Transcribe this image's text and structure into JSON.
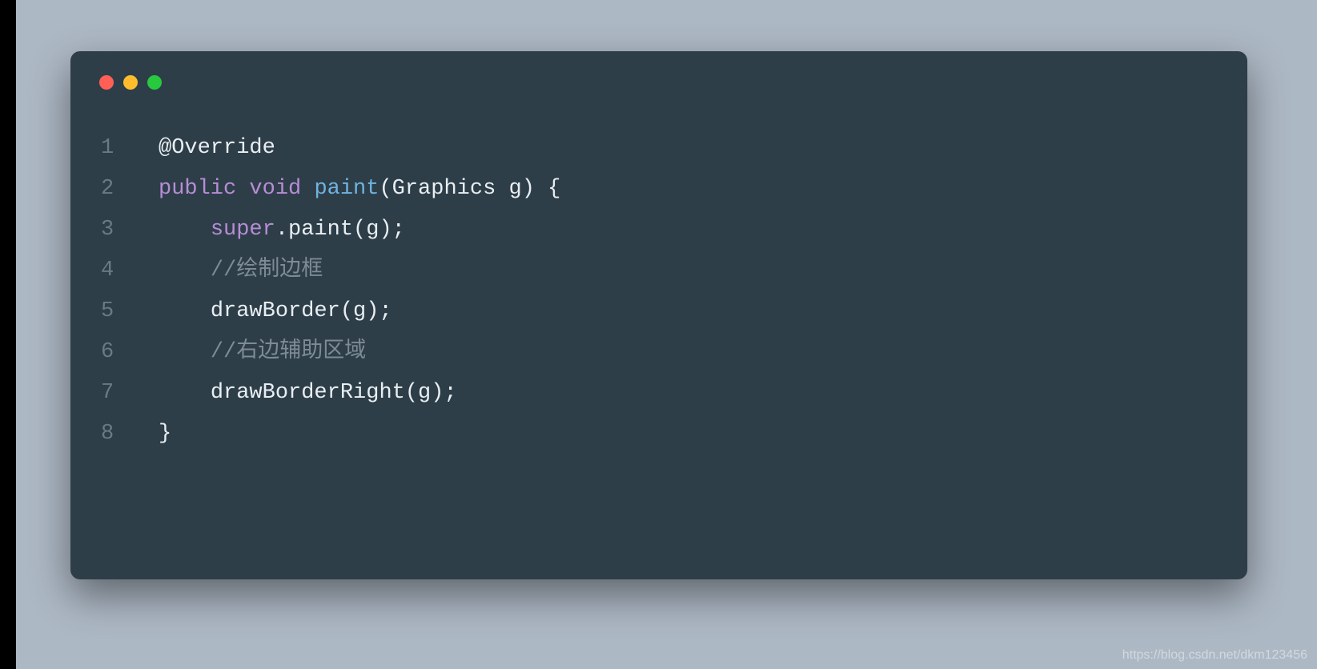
{
  "code": {
    "line1": {
      "number": "1",
      "annotation": "@Override"
    },
    "line2": {
      "number": "2",
      "kw_public": "public",
      "kw_void": "void",
      "method": "paint",
      "open_paren": "(",
      "type": "Graphics",
      "space": " ",
      "param": "g",
      "close_paren": ")",
      "brace": " {"
    },
    "line3": {
      "number": "3",
      "indent": "    ",
      "kw_super": "super",
      "dot": ".",
      "call": "paint(g);"
    },
    "line4": {
      "number": "4",
      "indent": "    ",
      "comment": "//绘制边框"
    },
    "line5": {
      "number": "5",
      "indent": "    ",
      "call": "drawBorder(g);"
    },
    "line6": {
      "number": "6",
      "indent": "    ",
      "comment": "//右边辅助区域"
    },
    "line7": {
      "number": "7",
      "indent": "    ",
      "call": "drawBorderRight(g);"
    },
    "line8": {
      "number": "8",
      "brace": "}"
    }
  },
  "watermark": "https://blog.csdn.net/dkm123456"
}
